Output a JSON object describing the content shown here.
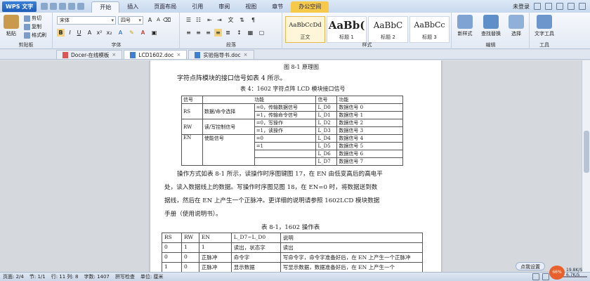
{
  "titlebar": {
    "app_name": "WPS 文字",
    "tabs": [
      "开始",
      "插入",
      "页面布局",
      "引用",
      "审阅",
      "视图",
      "章节",
      "办公空间"
    ],
    "user": "未登录"
  },
  "ribbon": {
    "clipboard": {
      "paste": "粘贴",
      "cut": "剪切",
      "copy": "复制",
      "format_painter": "格式刷",
      "label": "剪贴板"
    },
    "font": {
      "family": "宋体",
      "size": "四号",
      "label": "字体"
    },
    "paragraph": {
      "label": "段落"
    },
    "styles": {
      "items": [
        {
          "sample": "AaBbCcDd",
          "name": "正文"
        },
        {
          "sample": "AaBb(",
          "name": "标题 1"
        },
        {
          "sample": "AaBbC",
          "name": "标题 2"
        },
        {
          "sample": "AaBbCc",
          "name": "标题 3"
        }
      ],
      "label": "样式"
    },
    "new_style": "新样式",
    "find_replace": "查找替换",
    "select": "选择",
    "edit_label": "编辑",
    "text_tools": "文字工具",
    "tools_label": "工具"
  },
  "doctabs": [
    "Docer-在线模板",
    "LCD1602.doc",
    "实验指导书.doc"
  ],
  "doc": {
    "fig_caption": "图 8-1    原理图",
    "intro": "字符点阵模块的接口信号如表 4 所示。",
    "table4_title": "表 4：1602 字符点阵 LCD 模块接口信号",
    "table4": {
      "headers": [
        "信号",
        "功能",
        "信号",
        "功能"
      ],
      "rows": [
        [
          "RS",
          "数据/命令选择",
          "=0，传输数据信号",
          "L_D0",
          "数据信号 0"
        ],
        [
          "",
          "",
          "=1，传输命令信号",
          "L_D1",
          "数据信号 1"
        ],
        [
          "RW",
          "读/写控制信号",
          "=0，写操作",
          "L_D2",
          "数据信号 2"
        ],
        [
          "",
          "",
          "=1，读操作",
          "L_D3",
          "数据信号 3"
        ],
        [
          "EN",
          "使能信号",
          "=0",
          "L_D4",
          "数据信号 4"
        ],
        [
          "",
          "",
          "=1",
          "L_D5",
          "数据信号 5"
        ],
        [
          "",
          "",
          "",
          "L_D6",
          "数据信号 6"
        ],
        [
          "",
          "",
          "",
          "L_D7",
          "数据信号 7"
        ]
      ]
    },
    "para": [
      "操作方式如表 8-1 所示，读操作时序图键图 17，在 EN 由低变高后的高电平",
      "处，读入数据线上的数据。写操作时序图见图 18，在 EN=0 时，将数据送到数",
      "据线，然后在 EN 上产生一个正脉冲。更详细的说明请参照 1602LCD 模块数据",
      "手册（使用说明书）。"
    ],
    "table81_title": "表 8-1，1602 操作表",
    "table81": {
      "headers": [
        "RS",
        "RW",
        "EN",
        "L_D7~L_D0",
        "说明"
      ],
      "rows": [
        [
          "0",
          "1",
          "1",
          "读出，状态字",
          "读出"
        ],
        [
          "0",
          "0",
          "正脉冲",
          "命令字",
          "写命令字，命令字准备好后，在 EN 上产生一个正脉冲"
        ],
        [
          "1",
          "0",
          "正脉冲",
          "显示数据",
          "写显示数据，数据准备好后，在 EN 上产生一个"
        ]
      ]
    }
  },
  "status": {
    "page": "页面: 2/4",
    "section": "节: 1/1",
    "rowcol": "行: 11  列: 8",
    "words": "字数: 1407",
    "spell": "拼写检查",
    "unit": "单位: 厘米"
  },
  "overlay": {
    "notify": "点我设置",
    "badge": "66%",
    "up": "19.8K/S",
    "down": "6.7K/S"
  },
  "colors": {
    "accent": "#f6c94b",
    "app": "#1d5fb8"
  }
}
